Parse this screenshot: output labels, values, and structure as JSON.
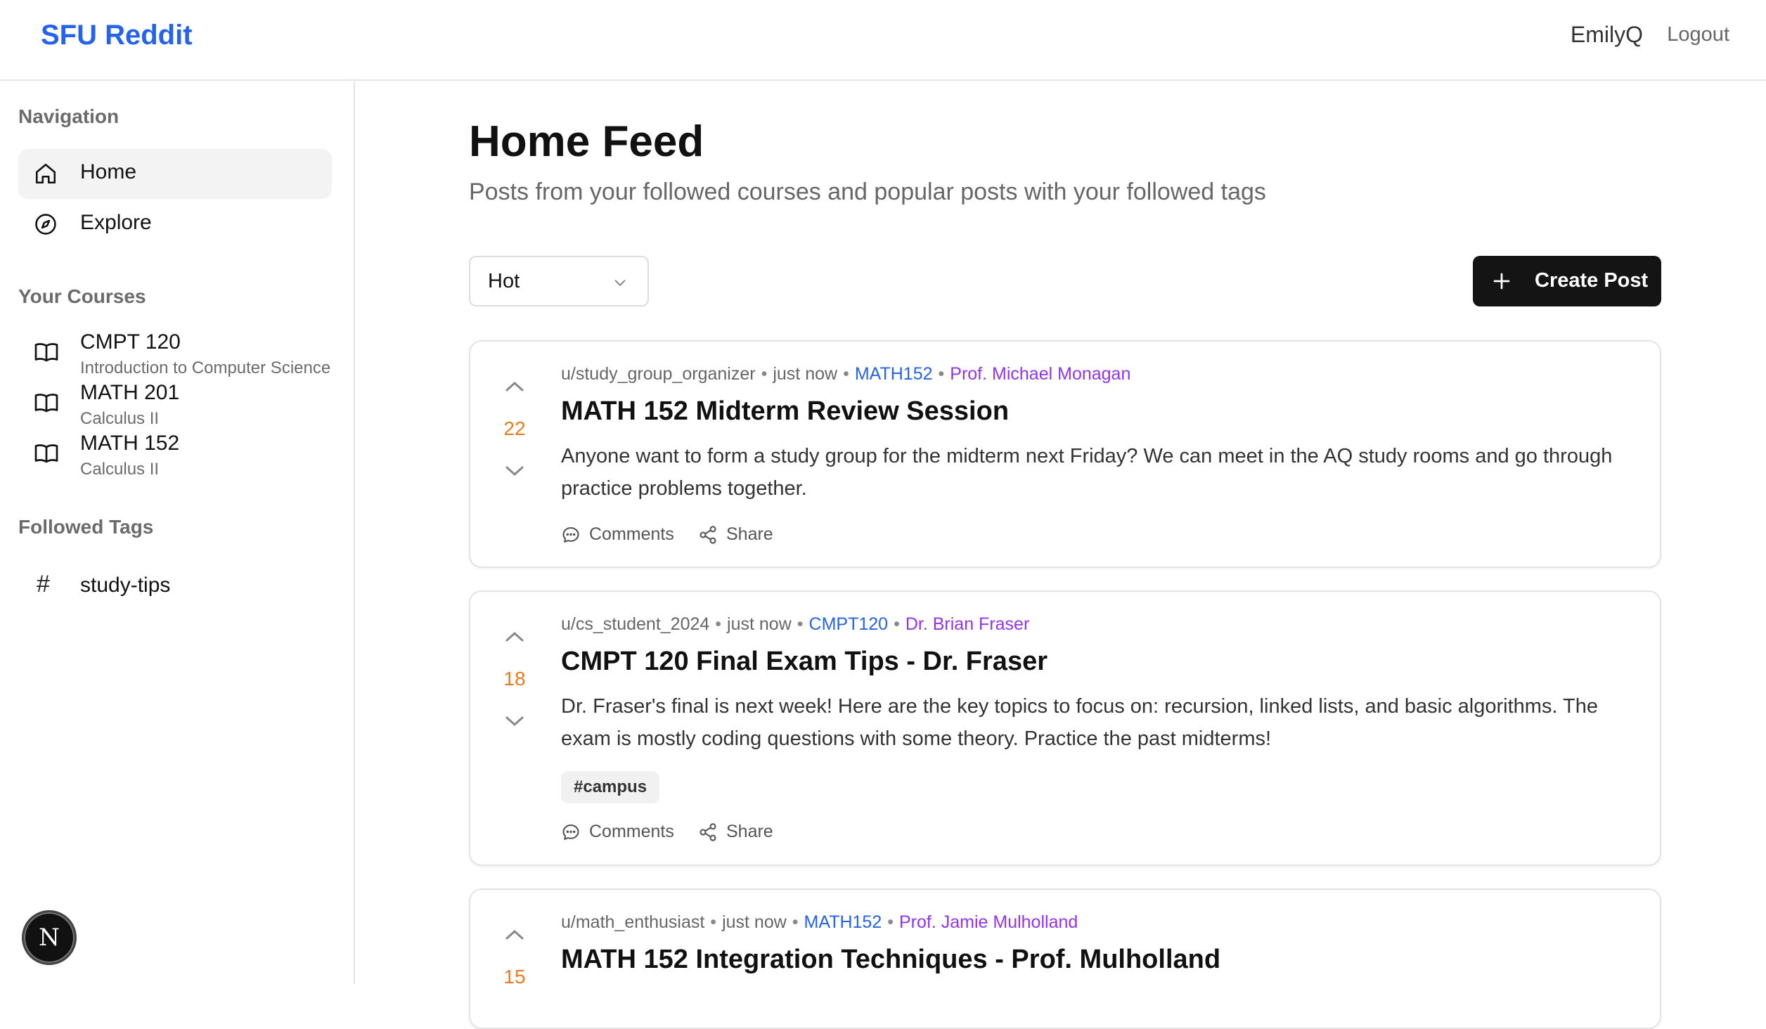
{
  "header": {
    "brand": "SFU Reddit",
    "username": "EmilyQ",
    "logout": "Logout"
  },
  "sidebar": {
    "nav_heading": "Navigation",
    "nav": [
      {
        "label": "Home",
        "icon": "home-icon",
        "active": true
      },
      {
        "label": "Explore",
        "icon": "compass-icon"
      }
    ],
    "courses_heading": "Your Courses",
    "courses": [
      {
        "code": "CMPT 120",
        "name": "Introduction to Computer Science"
      },
      {
        "code": "MATH 201",
        "name": "Calculus II"
      },
      {
        "code": "MATH 152",
        "name": "Calculus II"
      }
    ],
    "tags_heading": "Followed Tags",
    "tags": [
      {
        "hash": "#",
        "label": "study-tips"
      }
    ],
    "badge": "N"
  },
  "main": {
    "title": "Home Feed",
    "subtitle": "Posts from your followed courses and popular posts with your followed tags",
    "sort": {
      "value": "Hot"
    },
    "create_button": "Create Post"
  },
  "posts": [
    {
      "author": "u/study_group_organizer",
      "time": "just now",
      "course": "MATH152",
      "professor": "Prof. Michael Monagan",
      "votes": "22",
      "title": "MATH 152 Midterm Review Session",
      "body": "Anyone want to form a study group for the midterm next Friday? We can meet in the AQ study rooms and go through practice problems together.",
      "comments": "Comments",
      "share": "Share"
    },
    {
      "author": "u/cs_student_2024",
      "time": "just now",
      "course": "CMPT120",
      "professor": "Dr. Brian Fraser",
      "votes": "18",
      "title": "CMPT 120 Final Exam Tips - Dr. Fraser",
      "body": "Dr. Fraser's final is next week! Here are the key topics to focus on: recursion, linked lists, and basic algorithms. The exam is mostly coding questions with some theory. Practice the past midterms!",
      "tag": "#campus",
      "comments": "Comments",
      "share": "Share"
    },
    {
      "author": "u/math_enthusiast",
      "time": "just now",
      "course": "MATH152",
      "professor": "Prof. Jamie Mulholland",
      "votes": "15",
      "title": "MATH 152 Integration Techniques - Prof. Mulholland"
    }
  ],
  "colors": {
    "brand": "#2563eb",
    "course_link": "#2563eb",
    "professor": "#9333ea",
    "votes": "#ea7a1f",
    "button": "#141414"
  }
}
